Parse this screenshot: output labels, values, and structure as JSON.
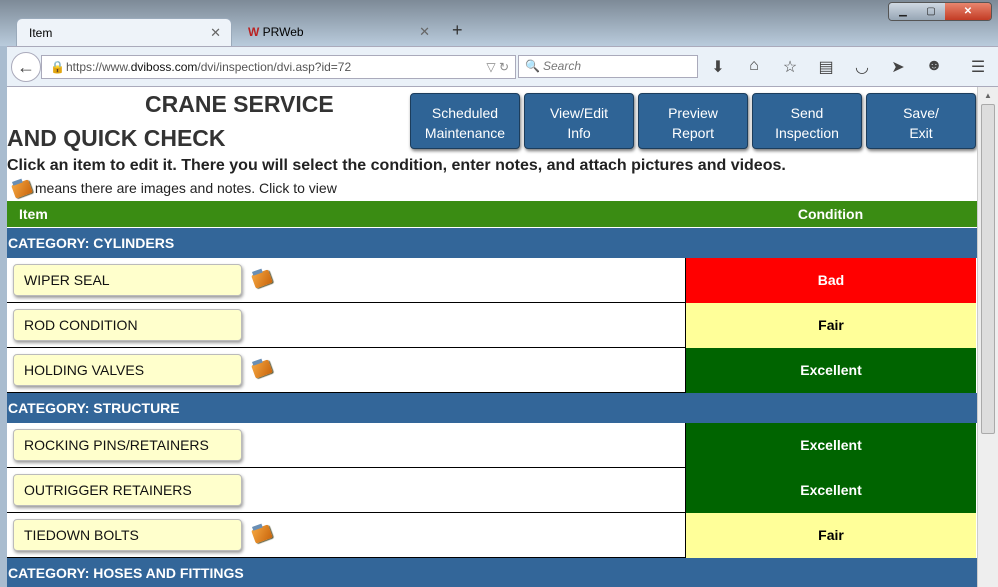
{
  "browser": {
    "tabs": [
      {
        "label": "Item"
      },
      {
        "label": "PRWeb"
      }
    ],
    "url_pre": "https://www.",
    "url_domain": "dviboss.com",
    "url_post": "/dvi/inspection/dvi.asp?id=72",
    "search_placeholder": "Search"
  },
  "page": {
    "title_line1": "CRANE SERVICE",
    "title_line2": "AND QUICK CHECK",
    "buttons": [
      "Scheduled\nMaintenance",
      "View/Edit\nInfo",
      "Preview\nReport",
      "Send\nInspection",
      "Save/\nExit"
    ],
    "instructions": "Click an item to edit it.  There you will select the condition, enter notes, and attach pictures and videos.",
    "legend": "means there are images and notes.  Click to view",
    "header_item": "Item",
    "header_condition": "Condition",
    "categories": [
      {
        "label": "CATEGORY: CYLINDERS",
        "rows": [
          {
            "item": "WIPER SEAL",
            "condition": "Bad",
            "media": true
          },
          {
            "item": "ROD CONDITION",
            "condition": "Fair",
            "media": false
          },
          {
            "item": "HOLDING VALVES",
            "condition": "Excellent",
            "media": true
          }
        ]
      },
      {
        "label": "CATEGORY: STRUCTURE",
        "rows": [
          {
            "item": "ROCKING PINS/RETAINERS",
            "condition": "Excellent",
            "media": false
          },
          {
            "item": "OUTRIGGER RETAINERS",
            "condition": "Excellent",
            "media": false
          },
          {
            "item": "TIEDOWN BOLTS",
            "condition": "Fair",
            "media": true
          }
        ]
      },
      {
        "label": "CATEGORY: HOSES AND FITTINGS",
        "rows": []
      }
    ]
  },
  "colors": {
    "Bad": "#ff0000",
    "Fair": "#ffff99",
    "Excellent": "#006400"
  }
}
